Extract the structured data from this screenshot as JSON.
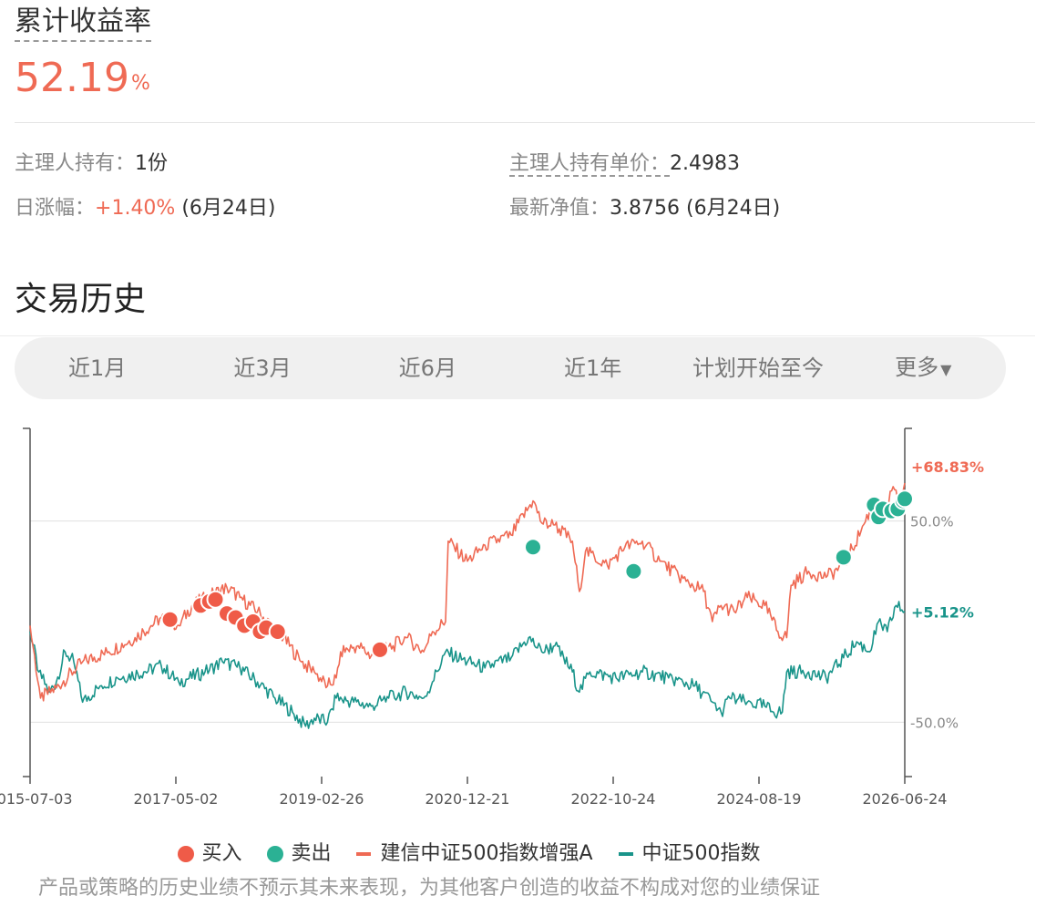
{
  "header": {
    "title": "累计收益率",
    "value": "52.19",
    "unit": "%"
  },
  "stats": {
    "holdings_label": "主理人持有：",
    "holdings_value": "1份",
    "unit_price_label": "主理人持有单价：",
    "unit_price_value": "2.4983",
    "daily_change_label": "日涨幅：",
    "daily_change_value": "+1.40%",
    "daily_change_date": "(6月24日)",
    "nav_label": "最新净值：",
    "nav_value": "3.8756",
    "nav_date": "(6月24日)"
  },
  "section": {
    "title": "交易历史"
  },
  "tabs": [
    {
      "label": "近1月"
    },
    {
      "label": "近3月"
    },
    {
      "label": "近6月"
    },
    {
      "label": "近1年"
    },
    {
      "label": "计划开始至今"
    },
    {
      "label": "更多",
      "caret": "▼"
    }
  ],
  "colors": {
    "accent_red": "#ef6a54",
    "accent_teal": "#19948a",
    "sell_marker": "#2bb194",
    "buy_marker": "#ef5b48"
  },
  "chart_data": {
    "type": "line",
    "x_ticks": [
      "2015-07-03",
      "2017-05-02",
      "2019-02-26",
      "2020-12-21",
      "2022-10-24",
      "2024-08-19",
      "2026-06-24"
    ],
    "y_ticks": [
      "50.0%",
      "-50.0%"
    ],
    "ylim": [
      -77,
      96
    ],
    "grid": true,
    "series": [
      {
        "name": "建信中证500指数增强A",
        "end_label": "+68.83%",
        "color": "#ef6a54",
        "points": [
          [
            0,
            -2
          ],
          [
            0.12,
            -38
          ],
          [
            0.3,
            -33
          ],
          [
            0.6,
            -20
          ],
          [
            0.9,
            -15
          ],
          [
            1.2,
            -8
          ],
          [
            1.5,
            2
          ],
          [
            1.7,
            -2
          ],
          [
            1.85,
            8
          ],
          [
            2.1,
            14
          ],
          [
            2.25,
            17
          ],
          [
            2.4,
            12
          ],
          [
            2.6,
            5
          ],
          [
            2.9,
            -8
          ],
          [
            3.1,
            -20
          ],
          [
            3.25,
            -25
          ],
          [
            3.4,
            -32
          ],
          [
            3.5,
            -28
          ],
          [
            3.55,
            -15
          ],
          [
            3.75,
            -12
          ],
          [
            3.9,
            -17
          ],
          [
            4.15,
            -12
          ],
          [
            4.3,
            -8
          ],
          [
            4.5,
            -15
          ],
          [
            4.6,
            -5
          ],
          [
            4.75,
            0
          ],
          [
            4.78,
            40
          ],
          [
            5.0,
            30
          ],
          [
            5.2,
            38
          ],
          [
            5.5,
            43
          ],
          [
            5.75,
            60
          ],
          [
            5.85,
            49
          ],
          [
            6.0,
            48
          ],
          [
            6.2,
            40
          ],
          [
            6.28,
            15
          ],
          [
            6.35,
            35
          ],
          [
            6.6,
            28
          ],
          [
            6.8,
            37
          ],
          [
            7.0,
            40
          ],
          [
            7.2,
            30
          ],
          [
            7.5,
            20
          ],
          [
            7.7,
            15
          ],
          [
            7.8,
            0
          ],
          [
            7.9,
            8
          ],
          [
            8.05,
            5
          ],
          [
            8.2,
            12
          ],
          [
            8.4,
            8
          ],
          [
            8.55,
            -5
          ],
          [
            8.65,
            -8
          ],
          [
            8.7,
            18
          ],
          [
            8.9,
            25
          ],
          [
            9.1,
            22
          ],
          [
            9.3,
            28
          ],
          [
            9.5,
            45
          ],
          [
            9.65,
            60
          ],
          [
            9.75,
            52
          ],
          [
            9.85,
            65
          ],
          [
            9.95,
            60
          ],
          [
            10,
            68.83
          ]
        ]
      },
      {
        "name": "中证500指数",
        "end_label": "+5.12%",
        "color": "#19948a",
        "points": [
          [
            0,
            -5
          ],
          [
            0.1,
            -25
          ],
          [
            0.22,
            -35
          ],
          [
            0.3,
            -30
          ],
          [
            0.4,
            -15
          ],
          [
            0.5,
            -20
          ],
          [
            0.6,
            -40
          ],
          [
            0.8,
            -32
          ],
          [
            1.0,
            -28
          ],
          [
            1.3,
            -25
          ],
          [
            1.5,
            -22
          ],
          [
            1.7,
            -30
          ],
          [
            2.0,
            -25
          ],
          [
            2.2,
            -20
          ],
          [
            2.4,
            -23
          ],
          [
            2.6,
            -30
          ],
          [
            2.8,
            -38
          ],
          [
            3.0,
            -45
          ],
          [
            3.15,
            -52
          ],
          [
            3.25,
            -48
          ],
          [
            3.4,
            -50
          ],
          [
            3.5,
            -38
          ],
          [
            3.7,
            -40
          ],
          [
            3.9,
            -42
          ],
          [
            4.1,
            -38
          ],
          [
            4.3,
            -35
          ],
          [
            4.5,
            -38
          ],
          [
            4.6,
            -30
          ],
          [
            4.75,
            -15
          ],
          [
            5.0,
            -20
          ],
          [
            5.2,
            -23
          ],
          [
            5.5,
            -18
          ],
          [
            5.7,
            -8
          ],
          [
            5.85,
            -15
          ],
          [
            6.0,
            -12
          ],
          [
            6.2,
            -25
          ],
          [
            6.28,
            -35
          ],
          [
            6.4,
            -25
          ],
          [
            6.7,
            -28
          ],
          [
            7.0,
            -25
          ],
          [
            7.3,
            -28
          ],
          [
            7.6,
            -32
          ],
          [
            7.8,
            -40
          ],
          [
            7.9,
            -45
          ],
          [
            8.0,
            -38
          ],
          [
            8.2,
            -40
          ],
          [
            8.4,
            -42
          ],
          [
            8.5,
            -45
          ],
          [
            8.6,
            -45
          ],
          [
            8.65,
            -25
          ],
          [
            8.9,
            -25
          ],
          [
            9.1,
            -28
          ],
          [
            9.3,
            -18
          ],
          [
            9.45,
            -10
          ],
          [
            9.6,
            -15
          ],
          [
            9.7,
            0
          ],
          [
            9.8,
            -5
          ],
          [
            9.9,
            8
          ],
          [
            10,
            5.12
          ]
        ]
      }
    ],
    "buy_points": [
      [
        1.6,
        1
      ],
      [
        1.95,
        8
      ],
      [
        2.05,
        10
      ],
      [
        2.12,
        11
      ],
      [
        2.25,
        4
      ],
      [
        2.35,
        2
      ],
      [
        2.45,
        -2
      ],
      [
        2.55,
        0
      ],
      [
        2.63,
        -5
      ],
      [
        2.7,
        -3
      ],
      [
        2.83,
        -5
      ],
      [
        4.0,
        -14
      ]
    ],
    "sell_points": [
      [
        5.75,
        37
      ],
      [
        6.9,
        25
      ],
      [
        9.3,
        32
      ],
      [
        9.65,
        58
      ],
      [
        9.7,
        52
      ],
      [
        9.75,
        56
      ],
      [
        9.85,
        55
      ],
      [
        9.92,
        56
      ],
      [
        9.98,
        60
      ],
      [
        10.0,
        61
      ]
    ]
  },
  "legend": {
    "buy": "买入",
    "sell": "卖出",
    "series_a": "建信中证500指数增强A",
    "series_b": "中证500指数"
  },
  "disclaimer": "产品或策略的历史业绩不预示其未来表现，为其他客户创造的收益不构成对您的业绩保证"
}
